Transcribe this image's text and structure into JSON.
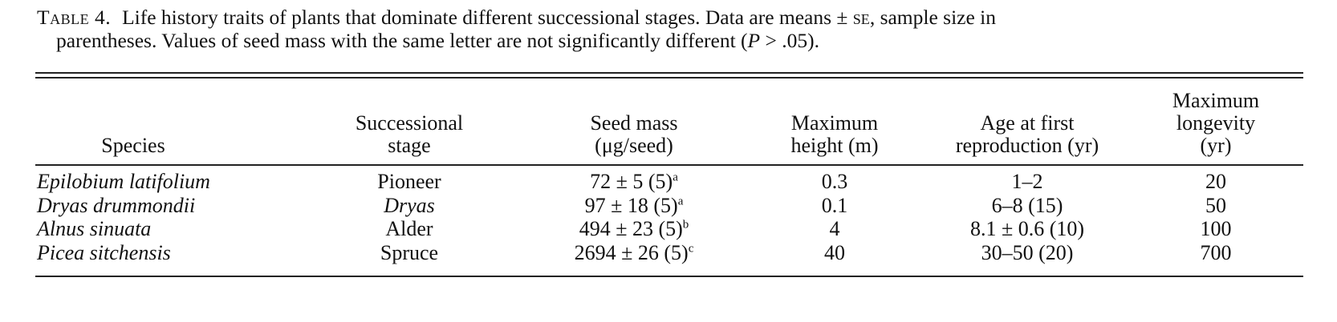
{
  "caption": {
    "label": "Table 4.",
    "text_1": "Life history traits of plants that dominate different successional stages. Data are means ± ",
    "se": "se",
    "text_2": ", sample size in",
    "line2_a": "parentheses. Values of seed mass with the same letter are not significantly different (",
    "p_symbol": "P",
    "line2_b": " > .05)."
  },
  "table": {
    "headers": {
      "species": [
        "Species"
      ],
      "stage": [
        "Successional",
        "stage"
      ],
      "seed": [
        "Seed mass",
        "(μg/seed)"
      ],
      "height": [
        "Maximum",
        "height (m)"
      ],
      "age": [
        "Age at first",
        "reproduction (yr)"
      ],
      "longevity": [
        "Maximum",
        "longevity",
        "(yr)"
      ]
    },
    "rows": [
      {
        "species": "Epilobium latifolium",
        "stage": "Pioneer",
        "stage_italic": false,
        "seed": "72 ± 5 (5)",
        "seed_letter": "a",
        "height": "0.3",
        "age": "1–2",
        "longevity": "20"
      },
      {
        "species": "Dryas drummondii",
        "stage": "Dryas",
        "stage_italic": true,
        "seed": "97 ± 18 (5)",
        "seed_letter": "a",
        "height": "0.1",
        "age": "6–8 (15)",
        "longevity": "50"
      },
      {
        "species": "Alnus sinuata",
        "stage": "Alder",
        "stage_italic": false,
        "seed": "494 ± 23 (5)",
        "seed_letter": "b",
        "height": "4",
        "age": "8.1 ± 0.6 (10)",
        "longevity": "100"
      },
      {
        "species": "Picea sitchensis",
        "stage": "Spruce",
        "stage_italic": false,
        "seed": "2694 ± 26 (5)",
        "seed_letter": "c",
        "height": "40",
        "age": "30–50 (20)",
        "longevity": "700"
      }
    ]
  }
}
